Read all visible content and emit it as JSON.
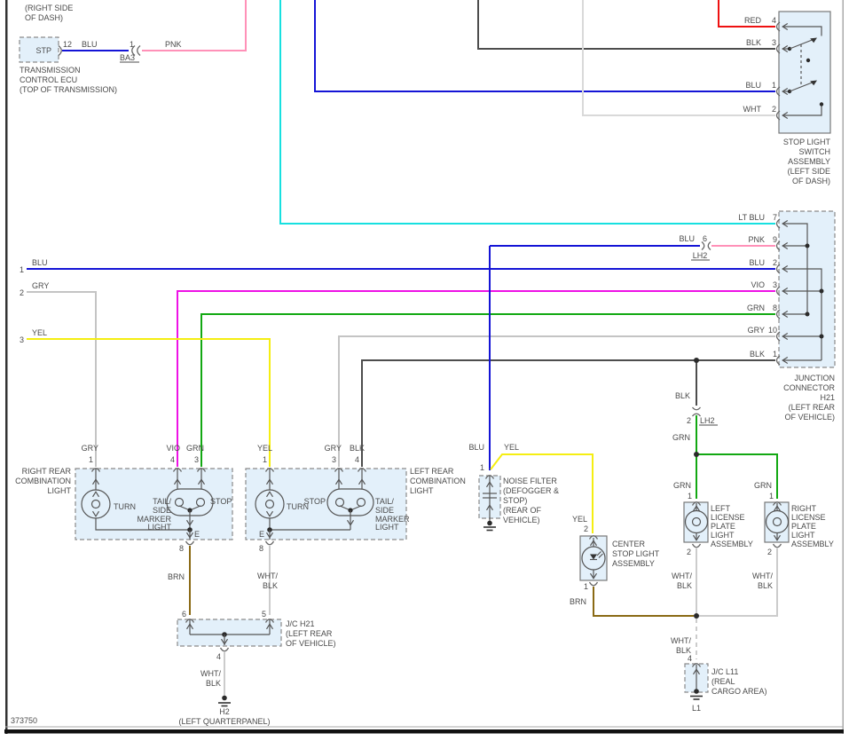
{
  "footer_id": "373750",
  "colors": {
    "red": "#ee1111",
    "blk": "#4d4d4d",
    "blu": "#1414d6",
    "wht": "#d9d9d9",
    "lt_blu": "#17e0e0",
    "pnk": "#ff91b8",
    "vio": "#ee12e6",
    "grn": "#12a812",
    "gry": "#c4c4c4",
    "yel": "#f5ee12",
    "brn": "#8a6a15",
    "wht_blk": "#cccccc"
  },
  "transmission_ecu": {
    "location_lines": [
      "(RIGHT SIDE",
      "OF DASH)"
    ],
    "box_label": "STP",
    "pin_out": "12",
    "wire": "BLU",
    "connector_pin": "1",
    "connector_ref": "BA3",
    "wire_out": "PNK",
    "caption_lines": [
      "TRANSMISSION",
      "CONTROL ECU",
      "(TOP OF TRANSMISSION)"
    ]
  },
  "stop_light_switch": {
    "pins": [
      {
        "wire": "RED",
        "num": "4"
      },
      {
        "wire": "BLK",
        "num": "3"
      },
      {
        "wire": "BLU",
        "num": "1"
      },
      {
        "wire": "WHT",
        "num": "2"
      }
    ],
    "caption_lines": [
      "STOP LIGHT",
      "SWITCH",
      "ASSEMBLY",
      "(LEFT SIDE",
      "OF DASH)"
    ]
  },
  "junction_connector_h21": {
    "pins": [
      {
        "wire": "LT BLU",
        "num": "7"
      },
      {
        "wire": "PNK",
        "num": "9"
      },
      {
        "wire": "BLU",
        "num": "2"
      },
      {
        "wire": "VIO",
        "num": "3"
      },
      {
        "wire": "GRN",
        "num": "8"
      },
      {
        "wire": "GRY",
        "num": "10"
      },
      {
        "wire": "BLK",
        "num": "1"
      }
    ],
    "caption_lines": [
      "JUNCTION",
      "CONNECTOR",
      "H21",
      "(LEFT REAR",
      "OF VEHICLE)"
    ]
  },
  "inline_connector_lh2_top": {
    "wire_in": "BLU",
    "pin": "6",
    "ref": "LH2"
  },
  "feed_wires": [
    {
      "num": "1",
      "color_label": "BLU"
    },
    {
      "num": "2",
      "color_label": "GRY"
    },
    {
      "num": "3",
      "color_label": "YEL"
    }
  ],
  "right_rear_combination_light": {
    "caption_lines": [
      "RIGHT REAR",
      "COMBINATION",
      "LIGHT"
    ],
    "pin_turn": {
      "wire": "GRY",
      "num": "1"
    },
    "pin_tail": {
      "wire": "VIO",
      "num": "4"
    },
    "pin_stop": {
      "wire": "GRN",
      "num": "3"
    },
    "turn_label": "TURN",
    "tail_lines": [
      "TAIL/",
      "SIDE",
      "MARKER",
      "LIGHT"
    ],
    "stop_label": "STOP",
    "ground_label": "E",
    "pin_bottom": "8",
    "wire_bottom": "BRN"
  },
  "left_rear_combination_light": {
    "caption_lines": [
      "LEFT REAR",
      "COMBINATION",
      "LIGHT"
    ],
    "pin_turn": {
      "wire": "YEL",
      "num": "1"
    },
    "pin_stop": {
      "wire": "GRY",
      "num": "3"
    },
    "pin_tail": {
      "wire": "BLK",
      "num": "4"
    },
    "turn_label": "TURN",
    "stop_label": "STOP",
    "tail_lines": [
      "TAIL/",
      "SIDE",
      "MARKER",
      "LIGHT"
    ],
    "ground_label": "E",
    "pin_bottom": "8",
    "wire_bottom_lines": [
      "WHT/",
      "BLK"
    ]
  },
  "noise_filter": {
    "wire_in": "BLU",
    "branch_wire": "YEL",
    "pin": "1",
    "caption_lines": [
      "NOISE FILTER",
      "(DEFOGGER &",
      "STOP)",
      "(REAR OF",
      "VEHICLE)"
    ]
  },
  "center_stop_light": {
    "wire_in": "YEL",
    "pin_top": "2",
    "pin_bottom": "1",
    "wire_out": "BRN",
    "caption_lines": [
      "CENTER",
      "STOP LIGHT",
      "ASSEMBLY"
    ]
  },
  "inline_connector_lh2_bottom": {
    "wire_in": "BLK",
    "pin": "2",
    "ref": "LH2",
    "wire_out": "GRN"
  },
  "left_license_light": {
    "wire_in": "GRN",
    "pin_top": "1",
    "pin_bottom": "2",
    "wire_out_lines": [
      "WHT/",
      "BLK"
    ],
    "caption_lines": [
      "LEFT",
      "LICENSE",
      "PLATE",
      "LIGHT",
      "ASSEMBLY"
    ]
  },
  "right_license_light": {
    "wire_in": "GRN",
    "pin_top": "1",
    "pin_bottom": "2",
    "wire_out_lines": [
      "WHT/",
      "BLK"
    ],
    "caption_lines": [
      "RIGHT",
      "LICENSE",
      "PLATE",
      "LIGHT",
      "ASSEMBLY"
    ]
  },
  "jc_h21": {
    "pin_left": "6",
    "pin_right": "5",
    "pin_bottom": "4",
    "wire_out_lines": [
      "WHT/",
      "BLK"
    ],
    "caption_lines": [
      "J/C H21",
      "(LEFT REAR",
      "OF VEHICLE)"
    ],
    "ground_name": "H2",
    "ground_caption": "(LEFT QUARTERPANEL)"
  },
  "jc_l11": {
    "wire_in_lines": [
      "WHT/",
      "BLK"
    ],
    "pin_top": "4",
    "caption_lines": [
      "J/C L11",
      "(REAL",
      "CARGO AREA)"
    ],
    "ground_name": "L1"
  }
}
